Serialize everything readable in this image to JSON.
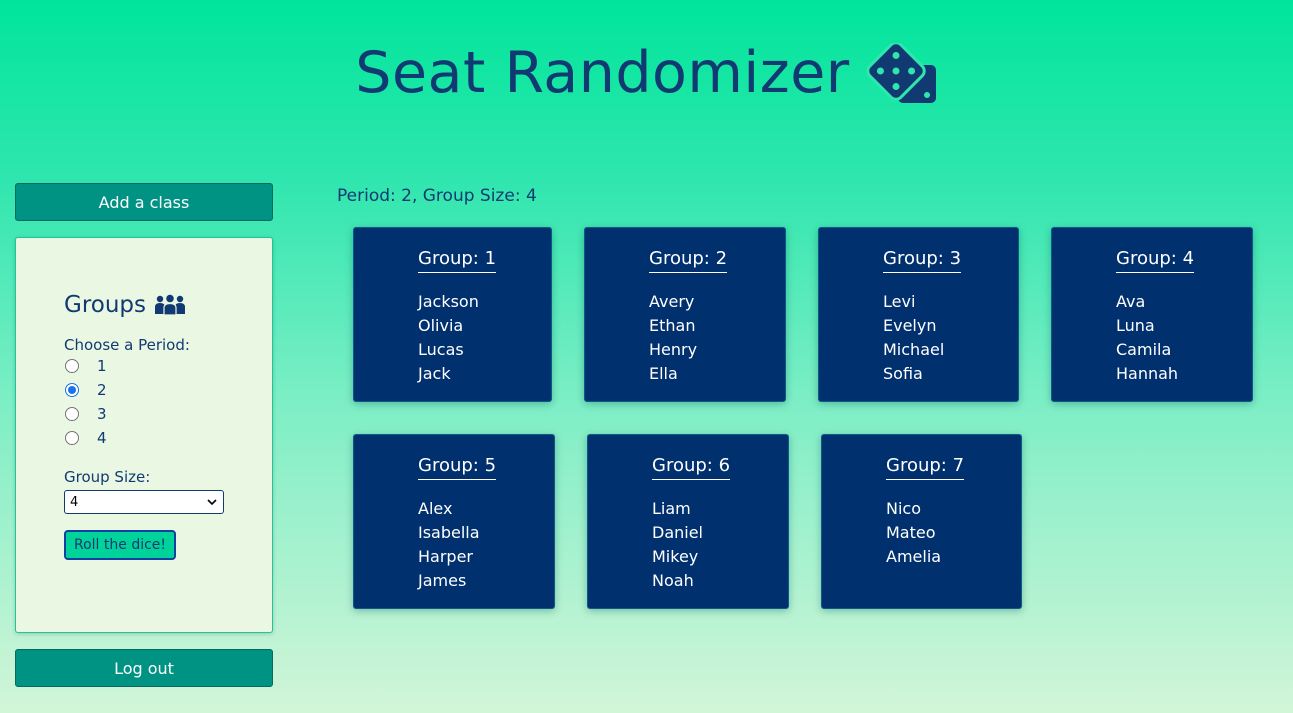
{
  "header": {
    "title": "Seat Randomizer",
    "icon": "dice-icon"
  },
  "sidebar": {
    "add_class_label": "Add a class",
    "logout_label": "Log out",
    "panel": {
      "heading": "Groups",
      "heading_icon": "people-group-icon",
      "choose_label": "Choose a Period:",
      "periods": [
        {
          "label": "1",
          "checked": false
        },
        {
          "label": "2",
          "checked": true
        },
        {
          "label": "3",
          "checked": false
        },
        {
          "label": "4",
          "checked": false
        }
      ],
      "group_size_label": "Group Size:",
      "group_size_value": "4",
      "roll_label": "Roll the dice!"
    }
  },
  "main": {
    "info": "Period: 2, Group Size: 4",
    "groups": [
      {
        "title": "Group: 1",
        "names": [
          "Jackson",
          "Olivia",
          "Lucas",
          "Jack"
        ]
      },
      {
        "title": "Group: 2",
        "names": [
          "Avery",
          "Ethan",
          "Henry",
          "Ella"
        ]
      },
      {
        "title": "Group: 3",
        "names": [
          "Levi",
          "Evelyn",
          "Michael",
          "Sofia"
        ]
      },
      {
        "title": "Group: 4",
        "names": [
          "Ava",
          "Luna",
          "Camila",
          "Hannah"
        ]
      },
      {
        "title": "Group: 5",
        "names": [
          "Alex",
          "Isabella",
          "Harper",
          "James"
        ]
      },
      {
        "title": "Group: 6",
        "names": [
          "Liam",
          "Daniel",
          "Mikey",
          "Noah"
        ]
      },
      {
        "title": "Group: 7",
        "names": [
          "Nico",
          "Mateo",
          "Amelia"
        ]
      }
    ]
  },
  "colors": {
    "accent": "#009384",
    "card": "#00306e",
    "text": "#123a72"
  }
}
